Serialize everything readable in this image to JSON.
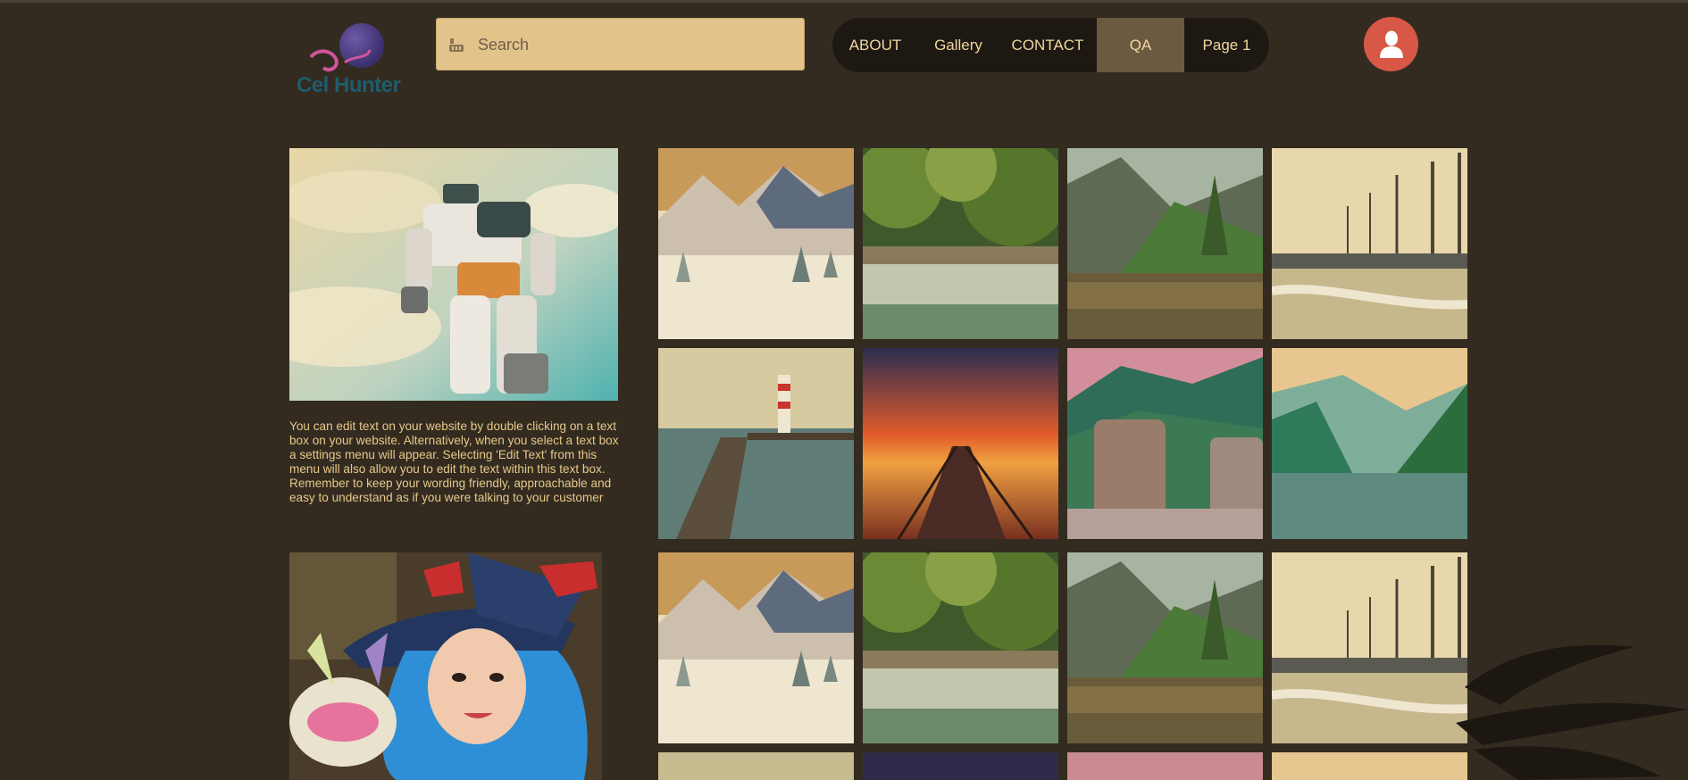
{
  "header": {
    "logo_text": "Cel Hunter",
    "search": {
      "placeholder": "Search",
      "icon": "youtube-icon"
    },
    "nav": [
      "ABOUT",
      "Gallery",
      "CONTACT",
      "QA",
      "Page 1"
    ],
    "active_nav": "QA",
    "avatar_icon": "user-icon"
  },
  "main": {
    "caption": "You can edit text on your website by double clicking on a text box on your website. Alternatively, when you select a text box a settings menu will appear. Selecting 'Edit Text' from this menu will also allow you to edit the text within this text box. Remember to keep your wording friendly, approachable and easy to understand as if you were talking to your customer"
  },
  "gallery": {
    "tiles": [
      "snowy-mountain",
      "forest-waterfall",
      "mountain-lake",
      "bare-trees-field",
      "lighthouse-pier",
      "sunset-pier",
      "rock-valley",
      "misty-river",
      "snowy-mountain",
      "forest-waterfall",
      "mountain-lake",
      "bare-trees-field",
      "lighthouse-pier",
      "sunset-pier",
      "rock-valley",
      "misty-river"
    ]
  },
  "colors": {
    "background": "#332b20",
    "search_bg": "#e2c38a",
    "nav_bg": "#1d1812",
    "nav_active": "#6b5a3f",
    "nav_text": "#f1d6a0",
    "avatar": "#d85846",
    "caption_text": "#e7c889"
  }
}
